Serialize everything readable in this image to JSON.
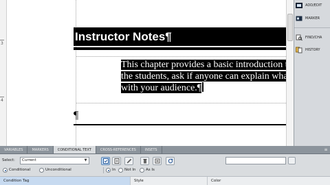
{
  "document": {
    "heading": "Instructor Notes¶",
    "body_lines": [
      "This chapter provides a basic introduction t",
      "the students, ask if anyone can explain wha",
      "with your audience."
    ],
    "body_end_mark": "¶",
    "empty_paragraph_mark": "¶",
    "ruler_numbers": [
      "3",
      "4"
    ]
  },
  "side_panel": {
    "items": [
      {
        "label": "ADD/EDIT",
        "icon": "add-edit-icon"
      },
      {
        "label": "MARKER",
        "icon": "marker-icon"
      },
      {
        "label": "FIND/CHA",
        "icon": "find-change-icon"
      },
      {
        "label": "HISTORY",
        "icon": "history-icon"
      }
    ]
  },
  "panel": {
    "tabs": [
      {
        "label": "VARIABLES",
        "active": false
      },
      {
        "label": "MARKERS",
        "active": false
      },
      {
        "label": "CONDITIONAL TEXT",
        "active": true
      },
      {
        "label": "CROSS-REFERENCES",
        "active": false
      },
      {
        "label": "INSETS",
        "active": false
      }
    ],
    "select_label": "Select:",
    "select_value": "Current",
    "toolbar_icons": [
      "apply-tag-icon",
      "new-tag-icon",
      "edit-tag-icon",
      "delete-tag-icon",
      "show-hide-icon",
      "refresh-icon"
    ],
    "filter": {
      "conditional": "Conditional",
      "unconditional": "Unconditional",
      "in": "In",
      "not_in": "Not In",
      "as_is": "As Is"
    },
    "columns": [
      "Condition Tag",
      "Style",
      "Color"
    ]
  },
  "colors": {
    "panel_tab_bar": "#8c949c",
    "panel_bg": "#d9dcdf",
    "side_bg": "#d6d9dd",
    "selection": "#000000"
  }
}
